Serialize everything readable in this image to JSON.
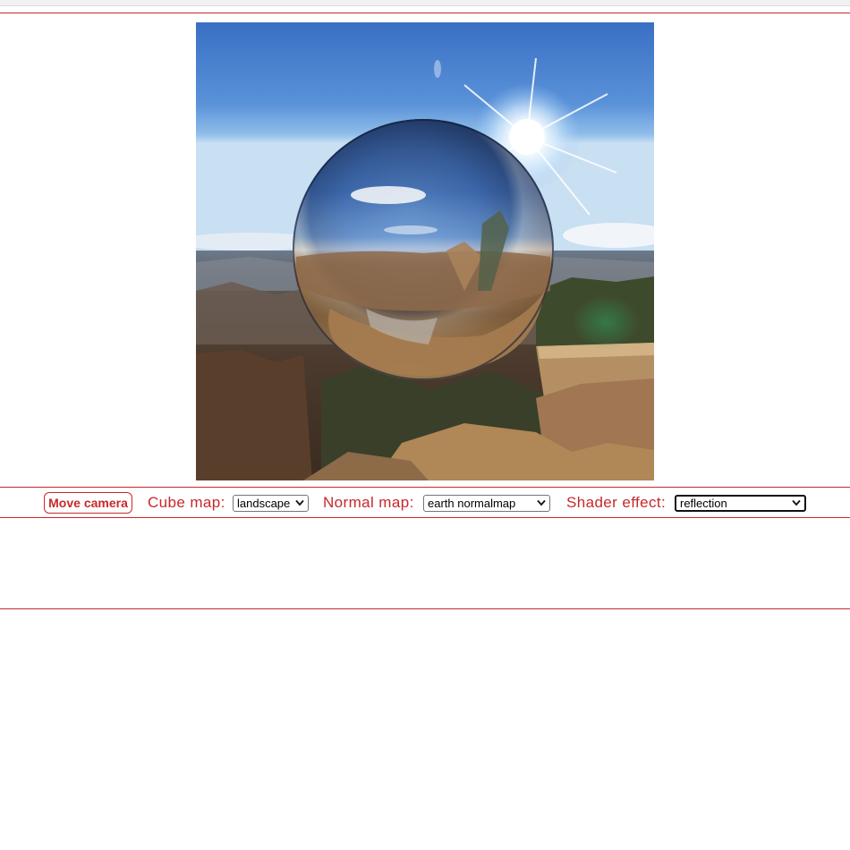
{
  "controls": {
    "move_camera_label": "Move camera",
    "cube_map": {
      "label": "Cube map:",
      "selected": "landscape"
    },
    "normal_map": {
      "label": "Normal map:",
      "selected": "earth normalmap"
    },
    "shader_effect": {
      "label": "Shader effect:",
      "selected": "reflection"
    }
  },
  "colors": {
    "accent": "#c8282a",
    "sky_top": "#3b71c6",
    "sky_horizon": "#a9cdef",
    "rock": "#b8895a"
  },
  "icons": {
    "select_arrow": "chevron-down-icon"
  }
}
